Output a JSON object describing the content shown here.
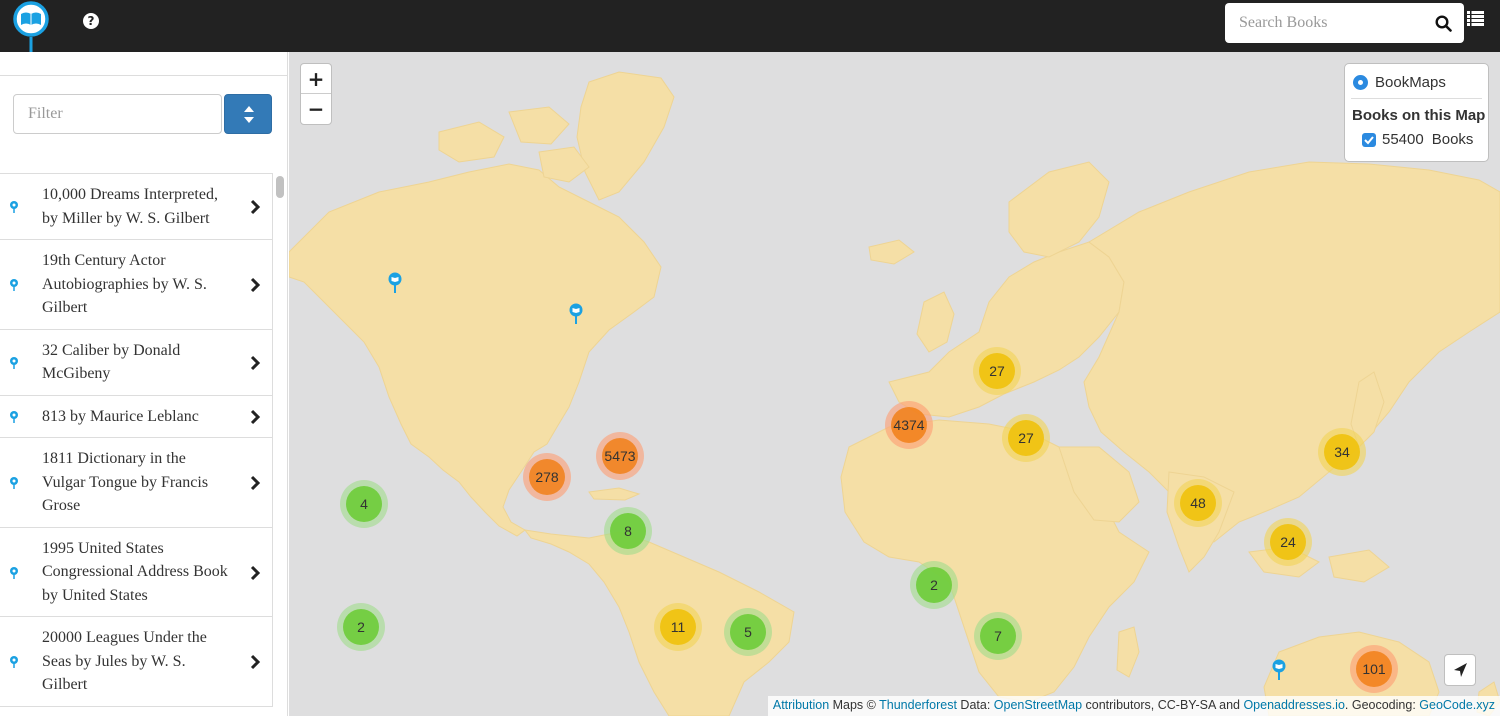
{
  "header": {
    "logo_icon": "book-map-pin-icon",
    "help_icon": "question-circle-icon",
    "help_glyph": "?",
    "search_placeholder": "Search Books",
    "search_icon": "search-icon",
    "list_icon": "list-view-icon",
    "background": "#222222"
  },
  "sidebar": {
    "filter_placeholder": "Filter",
    "sort_icon": "sort-icon",
    "items": [
      {
        "title": "10,000 Dreams Interpreted, by Miller by W. S. Gilbert"
      },
      {
        "title": "19th Century Actor Autobiographies by W. S. Gilbert"
      },
      {
        "title": "32 Caliber by Donald McGibeny"
      },
      {
        "title": "813 by Maurice Leblanc"
      },
      {
        "title": "1811 Dictionary in the Vulgar Tongue by Francis Grose"
      },
      {
        "title": "1995 United States Congressional Address Book by United States"
      },
      {
        "title": "20000 Leagues Under the Seas by Jules by W. S. Gilbert"
      }
    ]
  },
  "map": {
    "zoom_in": "+",
    "zoom_out": "−",
    "layers": {
      "base_layer": "BookMaps",
      "overlay_heading": "Books on this Map",
      "overlay_count": "55400",
      "overlay_label": "Books",
      "overlay_checked": true
    },
    "clusters": [
      {
        "label": "27",
        "level": "yellow"
      },
      {
        "label": "4374",
        "level": "orange"
      },
      {
        "label": "27",
        "level": "yellow"
      },
      {
        "label": "5473",
        "level": "orange"
      },
      {
        "label": "278",
        "level": "orange"
      },
      {
        "label": "34",
        "level": "yellow"
      },
      {
        "label": "48",
        "level": "yellow"
      },
      {
        "label": "4",
        "level": "green"
      },
      {
        "label": "8",
        "level": "green"
      },
      {
        "label": "24",
        "level": "yellow"
      },
      {
        "label": "2",
        "level": "green"
      },
      {
        "label": "2",
        "level": "green"
      },
      {
        "label": "11",
        "level": "yellow"
      },
      {
        "label": "5",
        "level": "green"
      },
      {
        "label": "7",
        "level": "green"
      },
      {
        "label": "101",
        "level": "orange"
      }
    ],
    "locate_icon": "locate-arrow-icon",
    "attribution": {
      "link1": "Attribution",
      "text1": " Maps © ",
      "link2": "Thunderforest",
      "text2": " Data: ",
      "link3": "OpenStreetMap",
      "text3": " contributors, CC-BY-SA and ",
      "link4": "Openaddresses.io",
      "text4": ". Geocoding: ",
      "link5": "GeoCode.xyz"
    },
    "colors": {
      "water": "#dededf",
      "land": "#f5dfa6",
      "cluster_green": "#6ecc39",
      "cluster_yellow": "#f0c20c",
      "cluster_orange": "#f18017",
      "accent": "#337ab7"
    }
  }
}
